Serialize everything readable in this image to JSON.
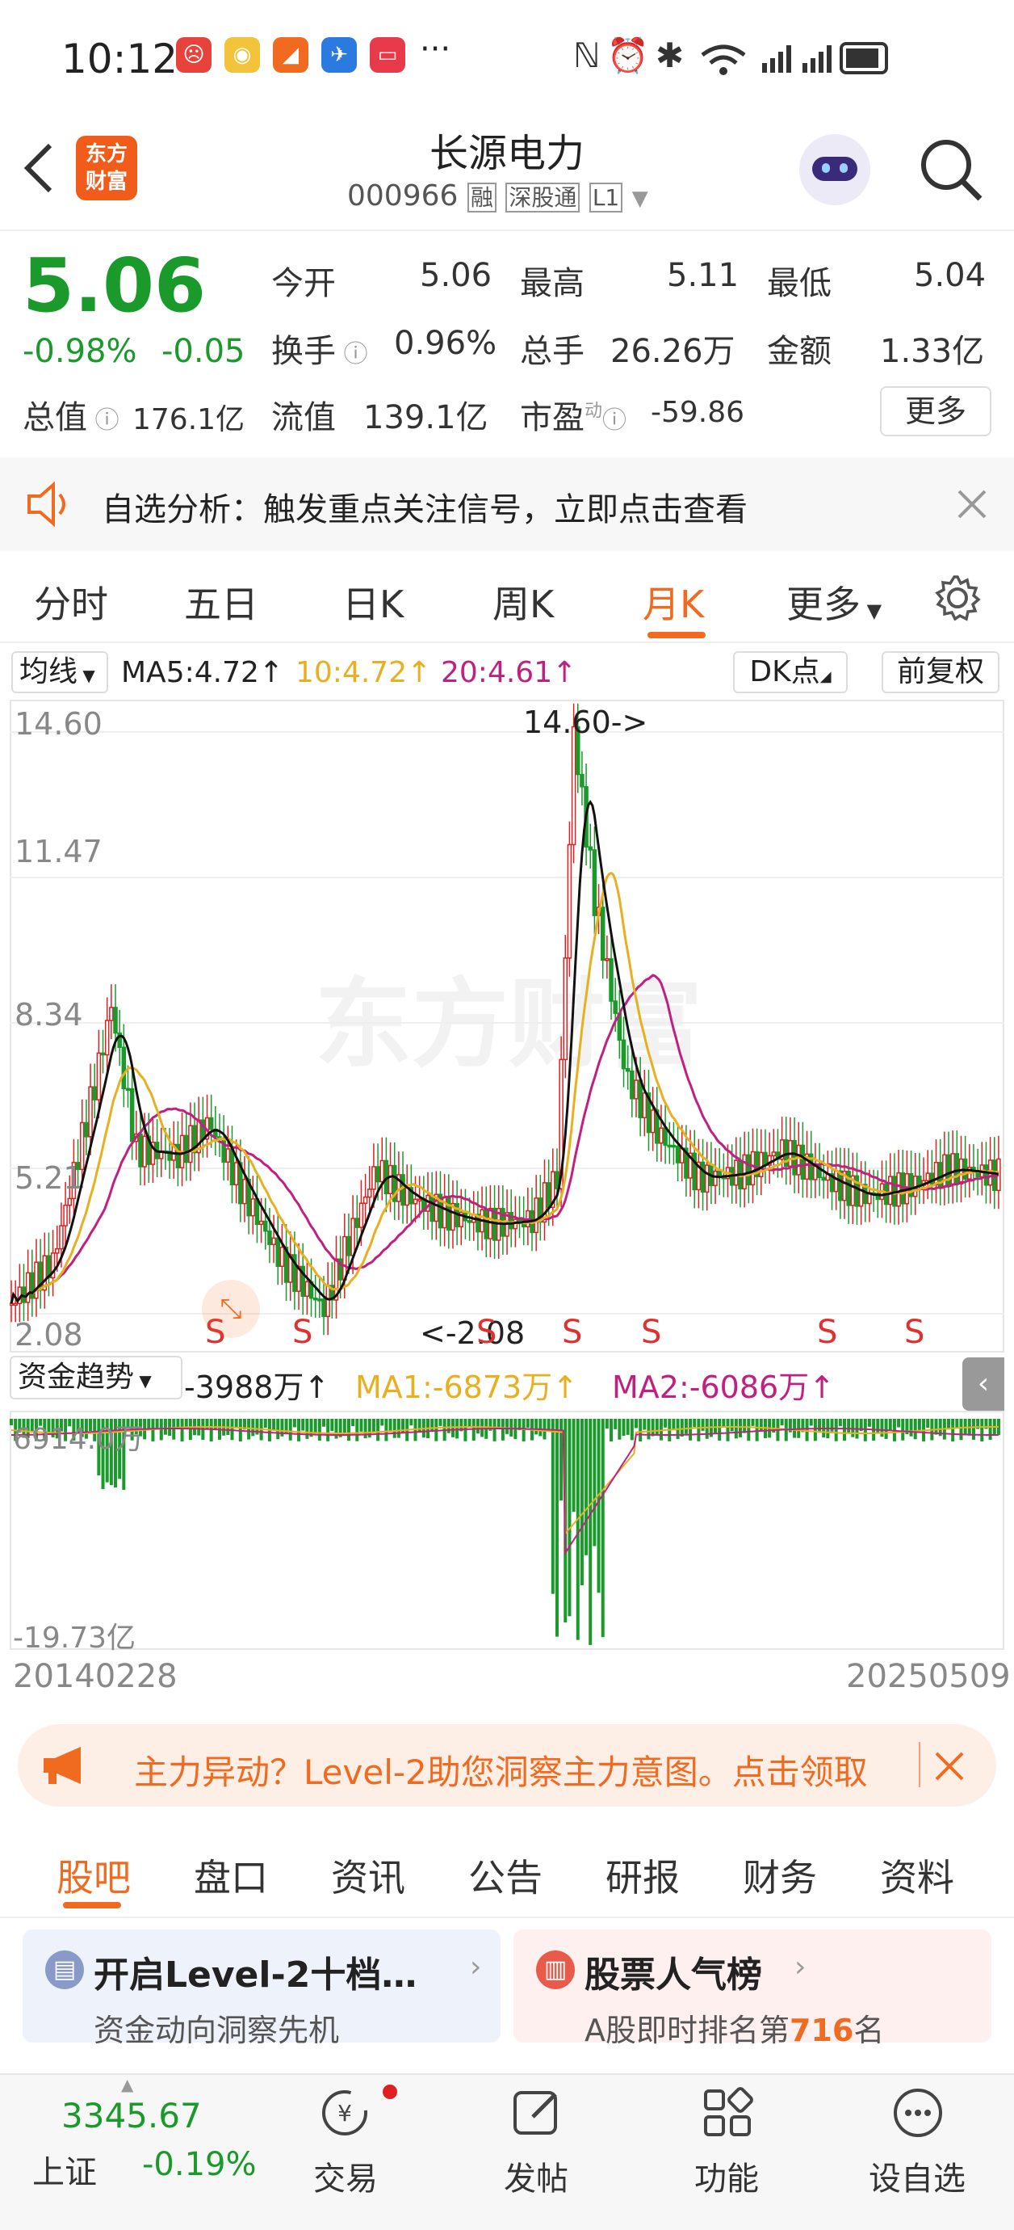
{
  "status": {
    "time": "10:12",
    "dots": "···"
  },
  "header": {
    "title": "长源电力",
    "code": "000966",
    "tag_rong": "融",
    "tag_sgt": "深股通",
    "tag_l1": "L1",
    "logo_line1": "东方",
    "logo_line2": "财富"
  },
  "quote": {
    "price": "5.06",
    "pct": "-0.98%",
    "chg": "-0.05",
    "open_label": "今开",
    "open": "5.06",
    "high_label": "最高",
    "high": "5.11",
    "low_label": "最低",
    "low": "5.04",
    "turn_label": "换手",
    "turn": "0.96%",
    "vol_label": "总手",
    "vol": "26.26万",
    "amt_label": "金额",
    "amt": "1.33亿",
    "mcap_label": "总值",
    "mcap": "176.1亿",
    "float_label": "流值",
    "float": "139.1亿",
    "pe_label": "市盈",
    "pe_sup": "动",
    "pe": "-59.86",
    "more": "更多"
  },
  "notice": {
    "text": "自选分析：触发重点关注信号，立即点击查看"
  },
  "period_tabs": [
    "分时",
    "五日",
    "日K",
    "周K",
    "月K",
    "更多"
  ],
  "active_tab": "月K",
  "chart_bar": {
    "ind": "均线",
    "ma5": "MA5:4.72↑",
    "ma10": "10:4.72↑",
    "ma20": "20:4.61↑",
    "dk": "DK点",
    "fq": "前复权"
  },
  "chart_data": {
    "type": "candlestick",
    "y_ticks": [
      "14.60",
      "11.47",
      "8.34",
      "5.21",
      "2.08"
    ],
    "ylim": [
      2.08,
      14.6
    ],
    "max_label": "14.60->",
    "min_label": "<-2.08",
    "s_markers": [
      "S",
      "S",
      "S",
      "S",
      "S",
      "S",
      "S"
    ],
    "x_start": "20140228",
    "x_end": "20250509",
    "watermark": "东方财富",
    "ma_colors": {
      "ma5": "#111111",
      "ma10": "#e8b020",
      "ma20": "#c02080"
    },
    "flow": {
      "label": "资金趋势",
      "value": "-3988万↑",
      "ma1": "MA1:-6873万↑",
      "ma2": "MA2:-6086万↑",
      "top": "6914.0万",
      "bottom": "-19.73亿"
    }
  },
  "promo": {
    "text": "主力异动？Level-2助您洞察主力意图。点击领取"
  },
  "sub_tabs": [
    "股吧",
    "盘口",
    "资讯",
    "公告",
    "研报",
    "财务",
    "资料"
  ],
  "active_sub": "股吧",
  "cards": [
    {
      "title": "开启Level-2十档…",
      "sub": "资金动向洞察先机"
    },
    {
      "title": "股票人气榜",
      "sub_pre": "A股即时排名第",
      "rank": "716",
      "sub_post": "名"
    }
  ],
  "bottom": {
    "index_val": "3345.67",
    "index_name": "上证",
    "index_pct": "-0.19%",
    "items": [
      "交易",
      "发帖",
      "功能",
      "设自选"
    ]
  }
}
